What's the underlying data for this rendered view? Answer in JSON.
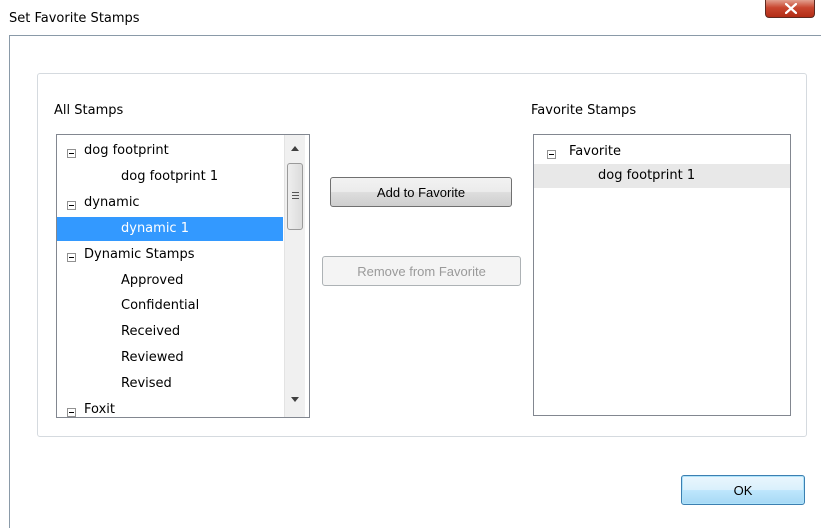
{
  "dialog": {
    "title": "Set Favorite Stamps"
  },
  "all_stamps": {
    "label": "All Stamps",
    "items": [
      {
        "text": "dog footprint",
        "level": 0,
        "expandable": true
      },
      {
        "text": "dog footprint 1",
        "level": 1
      },
      {
        "text": "dynamic",
        "level": 0,
        "expandable": true
      },
      {
        "text": "dynamic 1",
        "level": 1,
        "selected": true
      },
      {
        "text": "Dynamic Stamps",
        "level": 0,
        "expandable": true
      },
      {
        "text": "Approved",
        "level": 1
      },
      {
        "text": "Confidential",
        "level": 1
      },
      {
        "text": "Received",
        "level": 1
      },
      {
        "text": "Reviewed",
        "level": 1
      },
      {
        "text": "Revised",
        "level": 1
      },
      {
        "text": "Foxit",
        "level": 0,
        "expandable": true
      }
    ]
  },
  "favorite_stamps": {
    "label": "Favorite Stamps",
    "items": [
      {
        "text": "Favorite",
        "level": 0,
        "expandable": true
      },
      {
        "text": "dog footprint 1",
        "level": 1,
        "highlighted": true
      }
    ]
  },
  "buttons": {
    "add": "Add to Favorite",
    "remove": "Remove from Favorite",
    "ok": "OK"
  },
  "colors": {
    "selection": "#3399ff",
    "close_button": "#c8462f"
  }
}
